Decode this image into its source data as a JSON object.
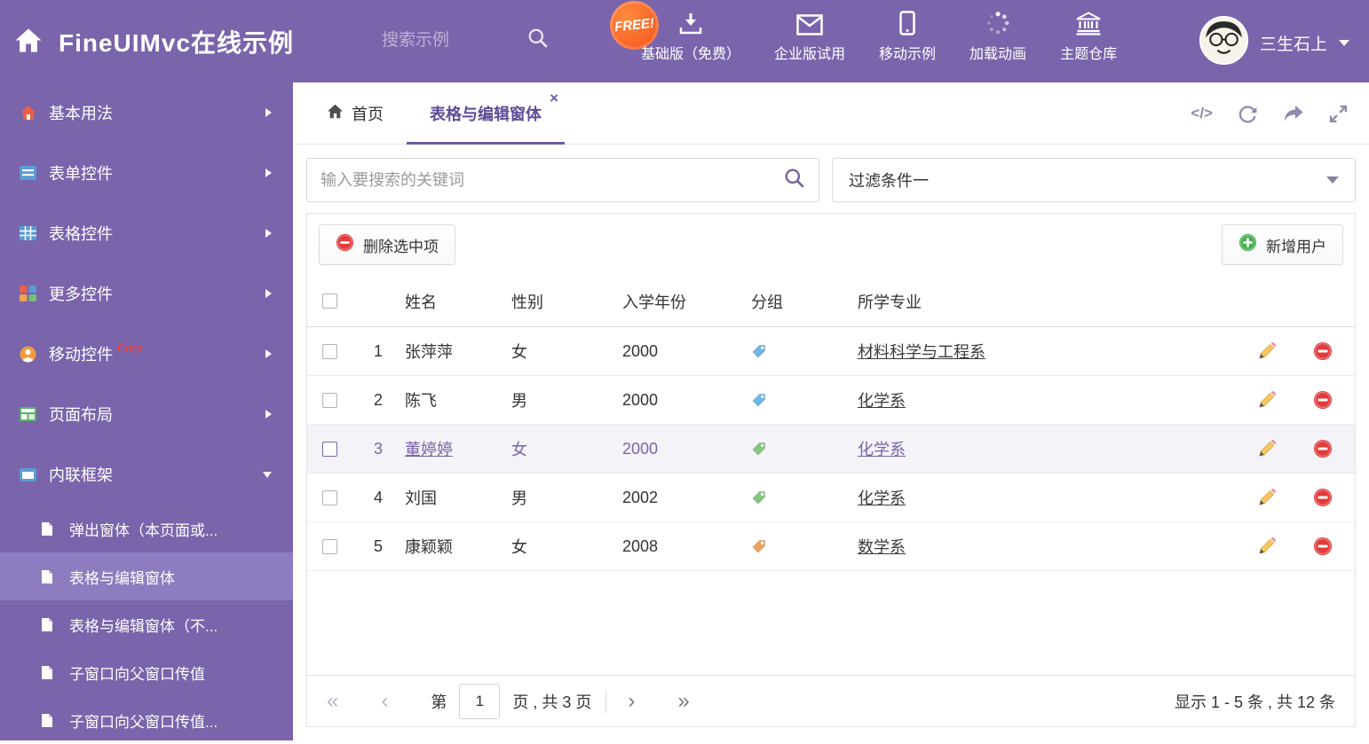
{
  "header": {
    "title": "FineUIMvc在线示例",
    "search_placeholder": "搜索示例",
    "free_badge": "FREE!",
    "nav_items": [
      {
        "label": "基础版（免费）",
        "icon": "download-icon"
      },
      {
        "label": "企业版试用",
        "icon": "mail-icon"
      },
      {
        "label": "移动示例",
        "icon": "mobile-icon"
      },
      {
        "label": "加载动画",
        "icon": "spinner-icon"
      },
      {
        "label": "主题仓库",
        "icon": "bank-icon"
      }
    ],
    "user_name": "三生石上"
  },
  "sidebar": {
    "items": [
      {
        "label": "基本用法"
      },
      {
        "label": "表单控件"
      },
      {
        "label": "表格控件"
      },
      {
        "label": "更多控件"
      },
      {
        "label": "移动控件",
        "badge": "Corp."
      },
      {
        "label": "页面布局"
      },
      {
        "label": "内联框架",
        "expanded": true
      }
    ],
    "subitems": [
      {
        "label": "弹出窗体（本页面或..."
      },
      {
        "label": "表格与编辑窗体",
        "active": true
      },
      {
        "label": "表格与编辑窗体（不..."
      },
      {
        "label": "子窗口向父窗口传值"
      },
      {
        "label": "子窗口向父窗口传值..."
      }
    ]
  },
  "tabs": {
    "home": "首页",
    "active": "表格与编辑窗体"
  },
  "search": {
    "placeholder": "输入要搜索的关键词"
  },
  "filter": {
    "selected": "过滤条件一"
  },
  "toolbar": {
    "delete_label": "删除选中项",
    "add_label": "新增用户"
  },
  "table": {
    "columns": {
      "name": "姓名",
      "gender": "性别",
      "year": "入学年份",
      "group": "分组",
      "major": "所学专业"
    },
    "rows": [
      {
        "num": "1",
        "name": "张萍萍",
        "gender": "女",
        "year": "2000",
        "tag_color": "#6db7e8",
        "major": "材料科学与工程系",
        "selected": false
      },
      {
        "num": "2",
        "name": "陈飞",
        "gender": "男",
        "year": "2000",
        "tag_color": "#6db7e8",
        "major": "化学系",
        "selected": false
      },
      {
        "num": "3",
        "name": "董婷婷",
        "gender": "女",
        "year": "2000",
        "tag_color": "#82c77e",
        "major": "化学系",
        "selected": true
      },
      {
        "num": "4",
        "name": "刘国",
        "gender": "男",
        "year": "2002",
        "tag_color": "#82c77e",
        "major": "化学系",
        "selected": false
      },
      {
        "num": "5",
        "name": "康颖颖",
        "gender": "女",
        "year": "2008",
        "tag_color": "#f2a25c",
        "major": "数学系",
        "selected": false
      }
    ]
  },
  "pagination": {
    "prefix": "第",
    "current_page": "1",
    "suffix": "页 , 共 3 页",
    "summary": "显示 1 - 5 条 , 共 12 条"
  },
  "glyphs": {
    "close": "×",
    "code": "</>",
    "first": "«",
    "prev": "‹",
    "next": "›",
    "last": "»"
  },
  "colors": {
    "theme_purple": "#7a64ab",
    "active_subitem": "#8d7cbf",
    "danger_red": "#e23b3b",
    "success_green": "#43b14b",
    "pencil_yellow": "#f6c863"
  }
}
